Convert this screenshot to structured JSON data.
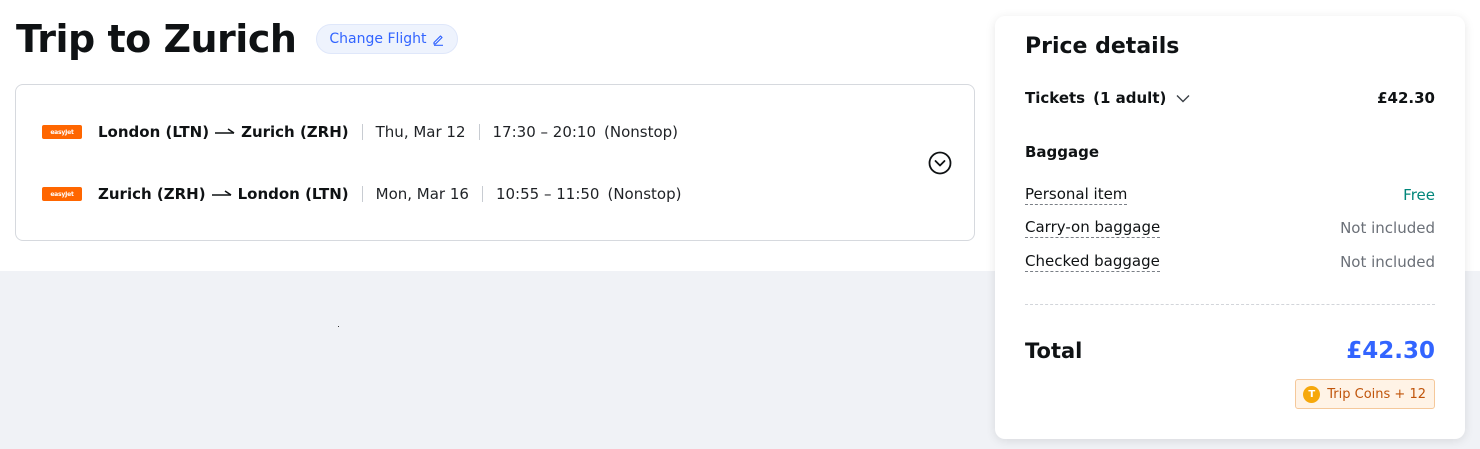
{
  "page": {
    "title": "Trip to Zurich",
    "change_flight_label": "Change Flight"
  },
  "flights": [
    {
      "airline": "easyJet",
      "origin": "London (LTN)",
      "destination": "Zurich (ZRH)",
      "date": "Thu, Mar 12",
      "time": "17:30 – 20:10",
      "stops": "(Nonstop)"
    },
    {
      "airline": "easyJet",
      "origin": "Zurich (ZRH)",
      "destination": "London (LTN)",
      "date": "Mon, Mar 16",
      "time": "10:55 – 11:50",
      "stops": "(Nonstop)"
    }
  ],
  "price_details": {
    "title": "Price details",
    "tickets_label": "Tickets",
    "tickets_count": "(1 adult)",
    "tickets_price": "£42.30",
    "baggage_heading": "Baggage",
    "baggage": [
      {
        "label": "Personal item",
        "value": "Free"
      },
      {
        "label": "Carry-on baggage",
        "value": "Not included"
      },
      {
        "label": "Checked baggage",
        "value": "Not included"
      }
    ],
    "total_label": "Total",
    "total_value": "£42.30",
    "coins_label": "Trip Coins + 12",
    "coin_icon_letter": "T"
  },
  "colors": {
    "accent": "#3264ff",
    "free": "#00867a",
    "airline_brand": "#ff6600",
    "coin": "#f6a80c"
  },
  "icons": {
    "edit": "pencil-icon",
    "arrow": "right-arrow-icon",
    "expand": "chevron-down-circle-icon",
    "tickets_toggle": "chevron-down-icon",
    "coin": "coin-icon"
  }
}
